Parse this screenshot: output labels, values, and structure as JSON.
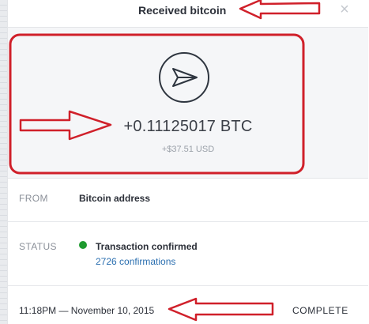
{
  "dialog": {
    "title": "Received bitcoin",
    "close_symbol": "×"
  },
  "transaction": {
    "amount": "+0.11125017 BTC",
    "fiat_amount": "+$37.51 USD",
    "from_label": "FROM",
    "from_value": "Bitcoin address",
    "status_label": "STATUS",
    "status_value": "Transaction confirmed",
    "confirmations": "2726 confirmations",
    "datetime": "11:18PM — November 10, 2015",
    "state": "COMPLETE"
  },
  "icons": {
    "send": "paper-plane-icon",
    "close": "close-icon",
    "status": "status-dot-icon"
  },
  "colors": {
    "status_confirmed": "#1e9a2f",
    "link": "#2b6fb0",
    "annotation": "#d0202a"
  }
}
